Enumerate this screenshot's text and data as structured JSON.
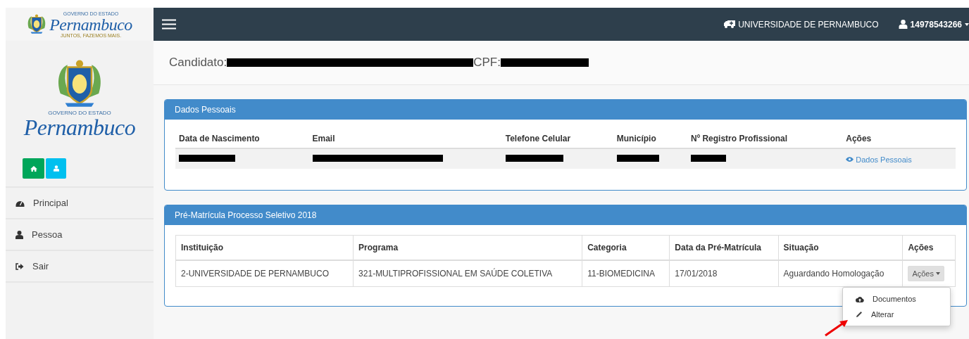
{
  "brand": {
    "small_top": "GOVERNO DO ESTADO",
    "name": "Pernambuco",
    "motto": "JUNTOS, FAZEMOS MAIS."
  },
  "sidebar": {
    "logo": {
      "small_top": "GOVERNO DO ESTADO",
      "name": "Pernambuco"
    },
    "items": [
      {
        "label": "Principal",
        "selected": false
      },
      {
        "label": "Pessoa",
        "selected": false
      },
      {
        "label": "Sair",
        "selected": false
      }
    ]
  },
  "topbar": {
    "institution": "UNIVERSIDADE DE PERNAMBUCO",
    "user": "14978543266"
  },
  "candidate": {
    "label": "Candidato:",
    "cpf_label": "CPF:"
  },
  "personal_panel": {
    "title": "Dados Pessoais",
    "columns": [
      "Data de Nascimento",
      "Email",
      "Telefone Celular",
      "Município",
      "Nº Registro Profissional",
      "Ações"
    ],
    "row": [
      {
        "kind": "redacted"
      },
      {
        "kind": "redacted"
      },
      {
        "kind": "redacted"
      },
      {
        "kind": "redacted"
      },
      {
        "kind": "redacted"
      },
      {
        "kind": "link",
        "text": "Dados Pessoais"
      }
    ]
  },
  "enrollment_panel": {
    "title": "Pré-Matrícula Processo Seletivo 2018",
    "columns": [
      "Instituição",
      "Programa",
      "Categoria",
      "Data da Pré-Matrícula",
      "Situação",
      "Ações"
    ],
    "rows": [
      {
        "cells": [
          "2-UNIVERSIDADE DE PERNAMBUCO",
          "321-MULTIPROFISSIONAL EM SAÚDE COLETIVA",
          "11-BIOMEDICINA",
          "17/01/2018",
          "Aguardando Homologação"
        ],
        "action": "Ações",
        "expanded": true
      }
    ],
    "menu": [
      {
        "label": "Documentos"
      },
      {
        "label": "Alterar"
      }
    ]
  }
}
